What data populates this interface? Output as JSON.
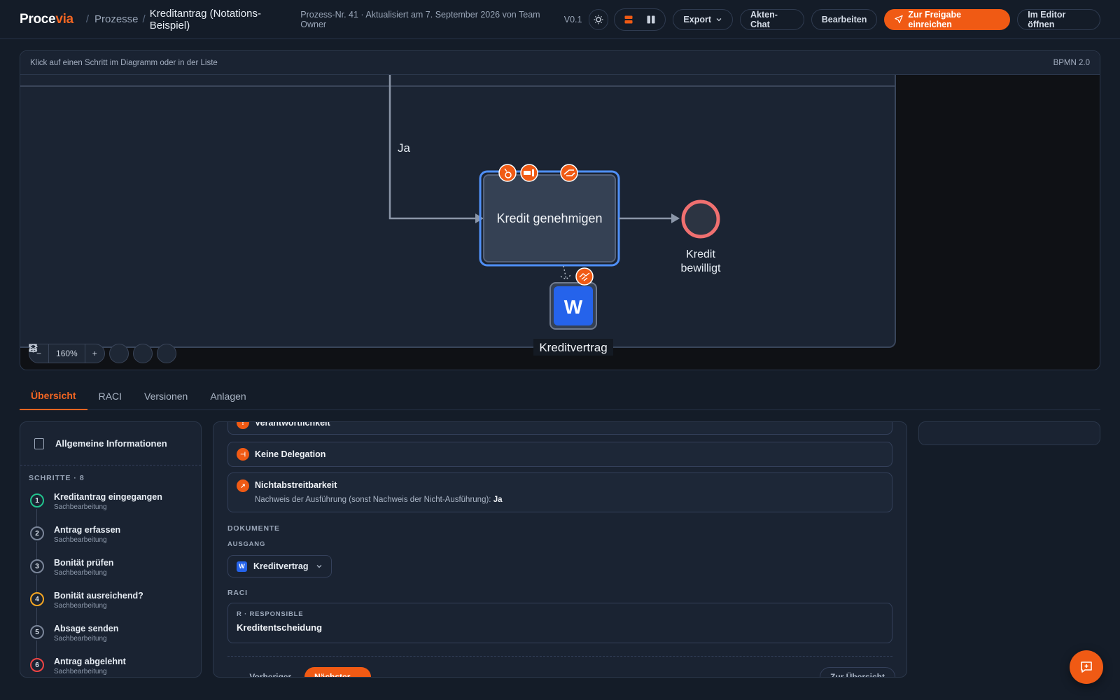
{
  "header": {
    "logo_main": "Proce",
    "logo_accent": "via",
    "breadcrumb_parent": "Prozesse",
    "breadcrumb_sep": "/",
    "breadcrumb_current": "Kreditantrag (Notations-Beispiel)",
    "meta": "Prozess-Nr. 41 · Aktualisiert am 7. September 2026 von Team Owner",
    "version": "V0.1",
    "export_label": "Export",
    "chat_label": "Akten-Chat",
    "edit_label": "Bearbeiten",
    "submit_label": "Zur Freigabe einreichen",
    "editor_label": "Im Editor öffnen",
    "accent_color": "#f05a14"
  },
  "diagram": {
    "hint": "Klick auf einen Schritt im Diagramm oder in der Liste",
    "notation": "BPMN 2.0",
    "flow_label": "Ja",
    "task_label": "Kredit genehmigen",
    "end_event_label_line1": "Kredit",
    "end_event_label_line2": "bewilligt",
    "document_label": "Kreditvertrag",
    "document_letter": "W",
    "zoom": "160%",
    "zoom_out": "−",
    "zoom_in": "+"
  },
  "tabs": [
    "Übersicht",
    "RACI",
    "Versionen",
    "Anlagen"
  ],
  "sidebar": {
    "general_info": "Allgemeine Informationen",
    "steps_title": "SCHRITTE · 8",
    "steps": [
      {
        "num": "1",
        "title": "Kreditantrag eingegangen",
        "role": "Sachbearbeitung",
        "color": "#22c38e"
      },
      {
        "num": "2",
        "title": "Antrag erfassen",
        "role": "Sachbearbeitung",
        "color": "#7a8599"
      },
      {
        "num": "3",
        "title": "Bonität prüfen",
        "role": "Sachbearbeitung",
        "color": "#7a8599"
      },
      {
        "num": "4",
        "title": "Bonität ausreichend?",
        "role": "Sachbearbeitung",
        "color": "#f5a623"
      },
      {
        "num": "5",
        "title": "Absage senden",
        "role": "Sachbearbeitung",
        "color": "#7a8599"
      },
      {
        "num": "6",
        "title": "Antrag abgelehnt",
        "role": "Sachbearbeitung",
        "color": "#ef4444"
      }
    ]
  },
  "detail": {
    "card_partial_title": "Verantwortlichkeit",
    "delegation_title": "Keine Delegation",
    "nonrep_title": "Nichtabstreitbarkeit",
    "nonrep_desc": "Nachweis der Ausführung (sonst Nachweis der Nicht-Ausführung):",
    "nonrep_value": "Ja",
    "documents_label": "DOKUMENTE",
    "output_label": "AUSGANG",
    "doc_chip": "Kreditvertrag",
    "doc_chip_letter": "W",
    "raci_label": "RACI",
    "raci_role": "R · RESPONSIBLE",
    "raci_value": "Kreditentscheidung",
    "prev_label": "← Vorheriger",
    "next_label": "Nächster →",
    "overview_label": "Zur Übersicht"
  }
}
